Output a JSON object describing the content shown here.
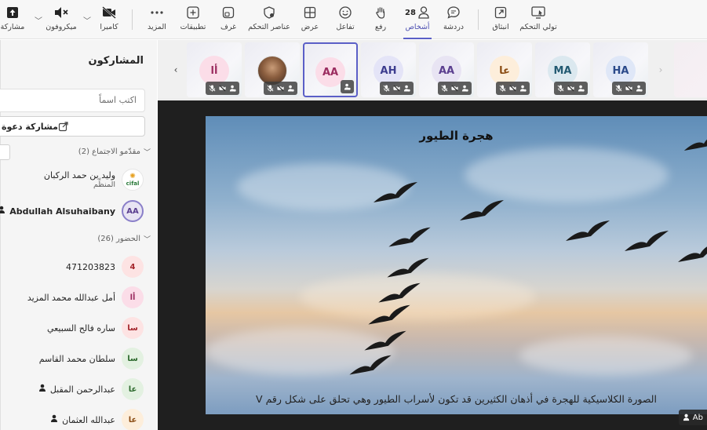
{
  "toolbar": {
    "share": "مشاركة",
    "mic": "ميكروفون",
    "camera": "كاميرا",
    "more": "المزيد",
    "apps": "تطبيقات",
    "rooms": "غرف",
    "controls": "عناصر التحكم",
    "view": "عرض",
    "react": "تفاعل",
    "raise": "رفع",
    "people": "أشخاص",
    "people_count": "28",
    "chat": "دردشة",
    "popout": "انبثاق",
    "take_control": "تولي التحكم"
  },
  "sidebar": {
    "title": "المشاركون",
    "search_placeholder": "اكتب اسماً",
    "invite_label": "مشاركة دعوة",
    "presenters_header": "مقدّمو الاجتماع (2)",
    "attendees_header": "الحضور (26)",
    "organizer": {
      "name": "وليد بن حمد الركبان",
      "role": "المنظِّم",
      "logo_text": "cifal"
    },
    "presenter2": {
      "initials": "AA",
      "name": "Abdullah Alsuhaibany"
    },
    "attendees": [
      {
        "initials": "4",
        "name": "471203823",
        "color": "#fde3e3",
        "fg": "#a4262c"
      },
      {
        "initials": "أا",
        "name": "أمل عبدالله محمد المزيد",
        "color": "#fbdde8",
        "fg": "#9b2c5f"
      },
      {
        "initials": "سا",
        "name": "ساره فالح السبيعي",
        "color": "#fde3e3",
        "fg": "#a4262c"
      },
      {
        "initials": "سا",
        "name": "سلطان محمد القاسم",
        "color": "#e3f1e1",
        "fg": "#2f6b2f"
      },
      {
        "initials": "عا",
        "name": "عبدالرحمن المقبل",
        "color": "#e3f1e1",
        "fg": "#2f6b2f"
      },
      {
        "initials": "عا",
        "name": "عبدالله العثمان",
        "color": "#fdeedb",
        "fg": "#8a4b12"
      }
    ]
  },
  "thumbnails": [
    {
      "initials": "HA",
      "color": "#dfe7f7",
      "fg": "#2b4a8a"
    },
    {
      "initials": "MA",
      "color": "#dbe8ef",
      "fg": "#235a72"
    },
    {
      "initials": "عا",
      "color": "#fdeedb",
      "fg": "#8a4b12"
    },
    {
      "initials": "AA",
      "color": "#e8e4f3",
      "fg": "#5b3f8f"
    },
    {
      "initials": "AH",
      "color": "#e4e4f7",
      "fg": "#3d3d8f"
    },
    {
      "initials": "AA",
      "color": "#fbdde8",
      "fg": "#9b2c5f"
    },
    {
      "initials": "",
      "color": "#7a5a44",
      "fg": "#ffffff"
    },
    {
      "initials": "أا",
      "color": "#fbdde8",
      "fg": "#9b2c5f"
    }
  ],
  "stage": {
    "slide_title": "هجرة الطيور",
    "slide_caption": "الصورة الكلاسيكية للهجرة في أذهان الكثيرين قد تكون لأسراب الطيور وهي تحلق على شكل رقم V",
    "presenter_badge": "Ab"
  }
}
